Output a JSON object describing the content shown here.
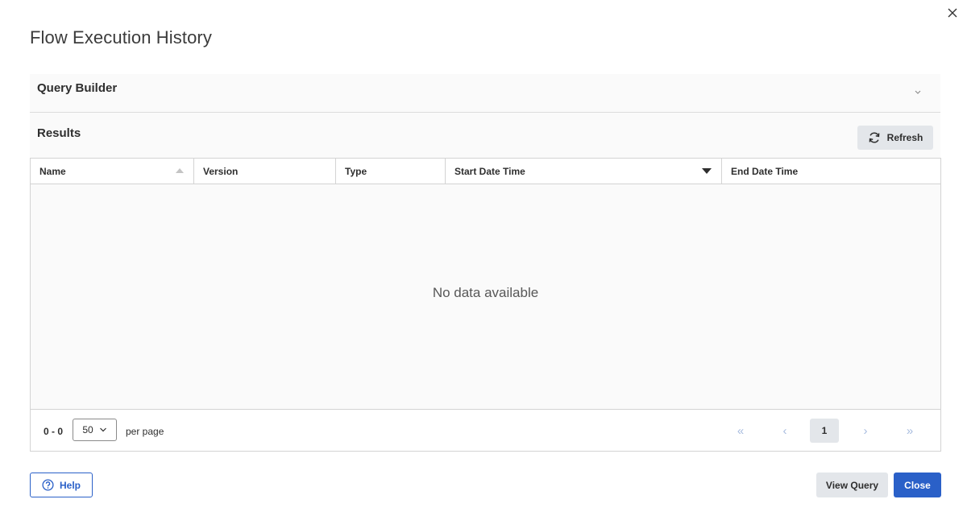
{
  "dialog": {
    "title": "Flow Execution History",
    "close_icon": "close-icon"
  },
  "query_builder": {
    "label": "Query Builder",
    "expand_icon": "chevron-down-icon"
  },
  "results": {
    "label": "Results",
    "refresh_label": "Refresh",
    "refresh_icon": "refresh-icon"
  },
  "table": {
    "columns": [
      {
        "label": "Name",
        "sort": "ascending-inactive"
      },
      {
        "label": "Version"
      },
      {
        "label": "Type"
      },
      {
        "label": "Start Date Time",
        "sort": "descending-active"
      },
      {
        "label": "End Date Time"
      }
    ],
    "empty_message": "No data available"
  },
  "pagination": {
    "range": "0 - 0",
    "page_size": "50",
    "per_page_label": "per page",
    "current_page": "1",
    "first_symbol": "«",
    "prev_symbol": "‹",
    "next_symbol": "›",
    "last_symbol": "»"
  },
  "footer": {
    "help_label": "Help",
    "view_query_label": "View Query",
    "close_label": "Close"
  },
  "colors": {
    "primary": "#2a60c8",
    "secondary_button": "#e3e6ea",
    "disabled_pager": "#a8bcdf"
  }
}
